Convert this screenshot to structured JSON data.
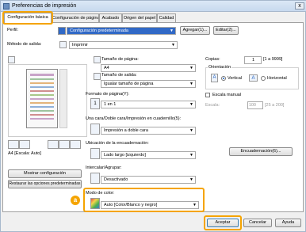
{
  "window": {
    "title": "Preferencias de impresión",
    "close_glyph": "x"
  },
  "tabs": [
    {
      "label": "Configuración básica"
    },
    {
      "label": "Configuración de página"
    },
    {
      "label": "Acabado"
    },
    {
      "label": "Origen del papel"
    },
    {
      "label": "Calidad"
    }
  ],
  "profile": {
    "label": "Perfil:",
    "value": "Configuración predeterminada",
    "add_button": "Agregar(1)...",
    "edit_button": "Editar(2)..."
  },
  "output": {
    "label": "Método de salida:",
    "value": "Imprimir"
  },
  "preview": {
    "status": "A4 [Escala: Auto]",
    "show_settings_button": "Mostrar configuración",
    "restore_button": "Restaurar las opciones predeterminadas"
  },
  "page_size": {
    "label": "Tamaño de página:",
    "value": "A4"
  },
  "output_size": {
    "label": "Tamaño de salida:",
    "value": "Igualar tamaño de página"
  },
  "copies": {
    "label": "Copias:",
    "value": "1",
    "range": "[1 a 9999]"
  },
  "orientation": {
    "label": "Orientación",
    "vertical": "Vertical",
    "horizontal": "Horizontal",
    "vertical_glyph": "A",
    "horizontal_glyph": "A"
  },
  "page_layout": {
    "label": "Formato de página(Y):",
    "value": "1 en 1",
    "icon_glyph": "1"
  },
  "manual_scale": {
    "label": "Escala manual",
    "scale_label": "Escala:",
    "value": "100",
    "range": "[25 a 200]"
  },
  "duplex": {
    "label": "Una cara/Doble cara/Impresión en cuadernillo(5):",
    "value": "Impresión a doble cara"
  },
  "binding": {
    "label": "Ubicación de la encuadernación:",
    "value": "Lado largo [izquierdo]",
    "margin_button": "Encuadernación(6)..."
  },
  "collate": {
    "label": "Intercalar/Agrupar:",
    "value": "Desactivado"
  },
  "color_mode": {
    "label": "Modo de color:",
    "value": "Auto [Color/Blanco y negro]"
  },
  "callout": {
    "label": "a"
  },
  "footer": {
    "ok": "Aceptar",
    "cancel": "Cancelar",
    "help": "Ayuda"
  },
  "colors": {
    "highlight": "#f5a400",
    "selection": "#3169c6"
  }
}
